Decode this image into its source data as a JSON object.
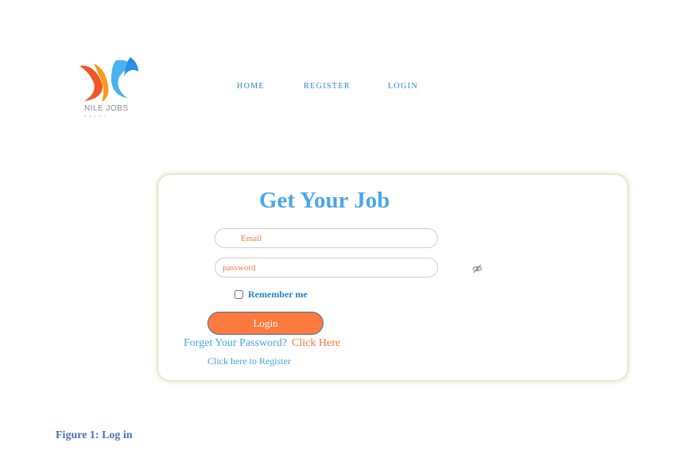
{
  "logo": {
    "brand": "NILE JOBS",
    "sub": "egypt"
  },
  "nav": {
    "home": "HOME",
    "register": "REGISTER",
    "login": "LOGIN"
  },
  "form": {
    "title": "Get Your Job",
    "email_placeholder": "Email",
    "password_placeholder": "password",
    "remember_label": "Remember me",
    "login_button": "Login",
    "forget_text": "Forget Your Password?",
    "forget_link": "Click Here",
    "register_link": "Click here to Register"
  },
  "caption": "Figure 1: Log in",
  "icons": {
    "password_toggle": "eye-slash-icon"
  },
  "colors": {
    "accent_blue": "#4aa8e6",
    "nav_blue": "#2c86d1",
    "button_orange": "#ff7a3d",
    "link_orange": "#f07a3a",
    "caption_blue": "#4a73b4"
  }
}
